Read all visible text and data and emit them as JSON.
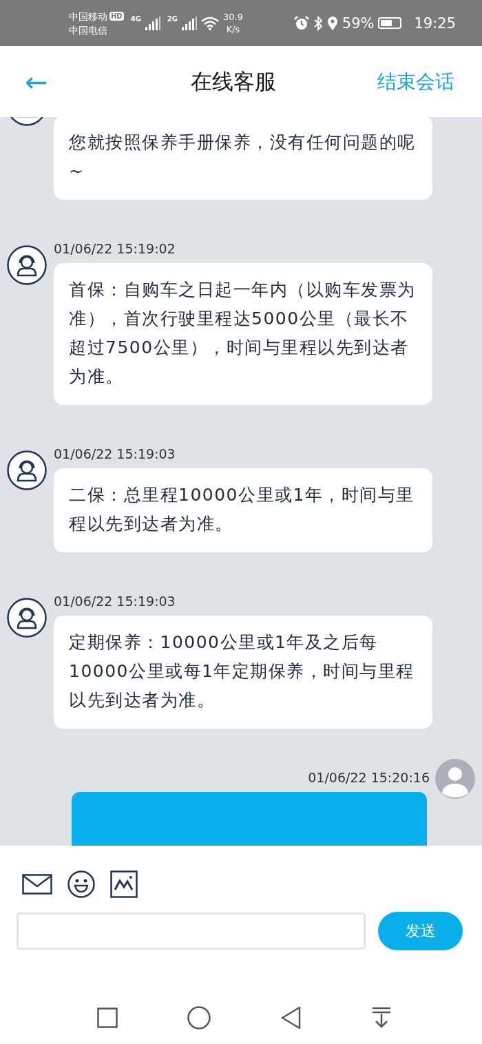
{
  "status_bar": {
    "carrier_1": "中国移动",
    "hd_badge": "HD",
    "carrier_2": "中国电信",
    "network_1": "4G",
    "network_2": "2G",
    "speed_value": "30.9",
    "speed_unit": "K/s",
    "battery_percent": "59%",
    "time": "19:25"
  },
  "header": {
    "back_icon": "←",
    "title": "在线客服",
    "end_button": "结束会话"
  },
  "messages": [
    {
      "kind": "agent",
      "text": "您就按照保养手册保养，没有任何问题的呢~"
    },
    {
      "kind": "agent",
      "timestamp": "01/06/22 15:19:02",
      "text": "首保：自购车之日起一年内（以购车发票为准），首次行驶里程达5000公里（最长不超过7500公里），时间与里程以先到达者为准。"
    },
    {
      "kind": "agent",
      "timestamp": "01/06/22 15:19:03",
      "text": "二保：总里程10000公里或1年，时间与里程以先到达者为准。"
    },
    {
      "kind": "agent",
      "timestamp": "01/06/22 15:19:03",
      "text": "定期保养：10000公里或1年及之后每10000公里或每1年定期保养，时间与里程以先到达者为准。"
    },
    {
      "kind": "user",
      "timestamp": "01/06/22 15:20:16"
    }
  ],
  "composer": {
    "send_button": "发送"
  }
}
